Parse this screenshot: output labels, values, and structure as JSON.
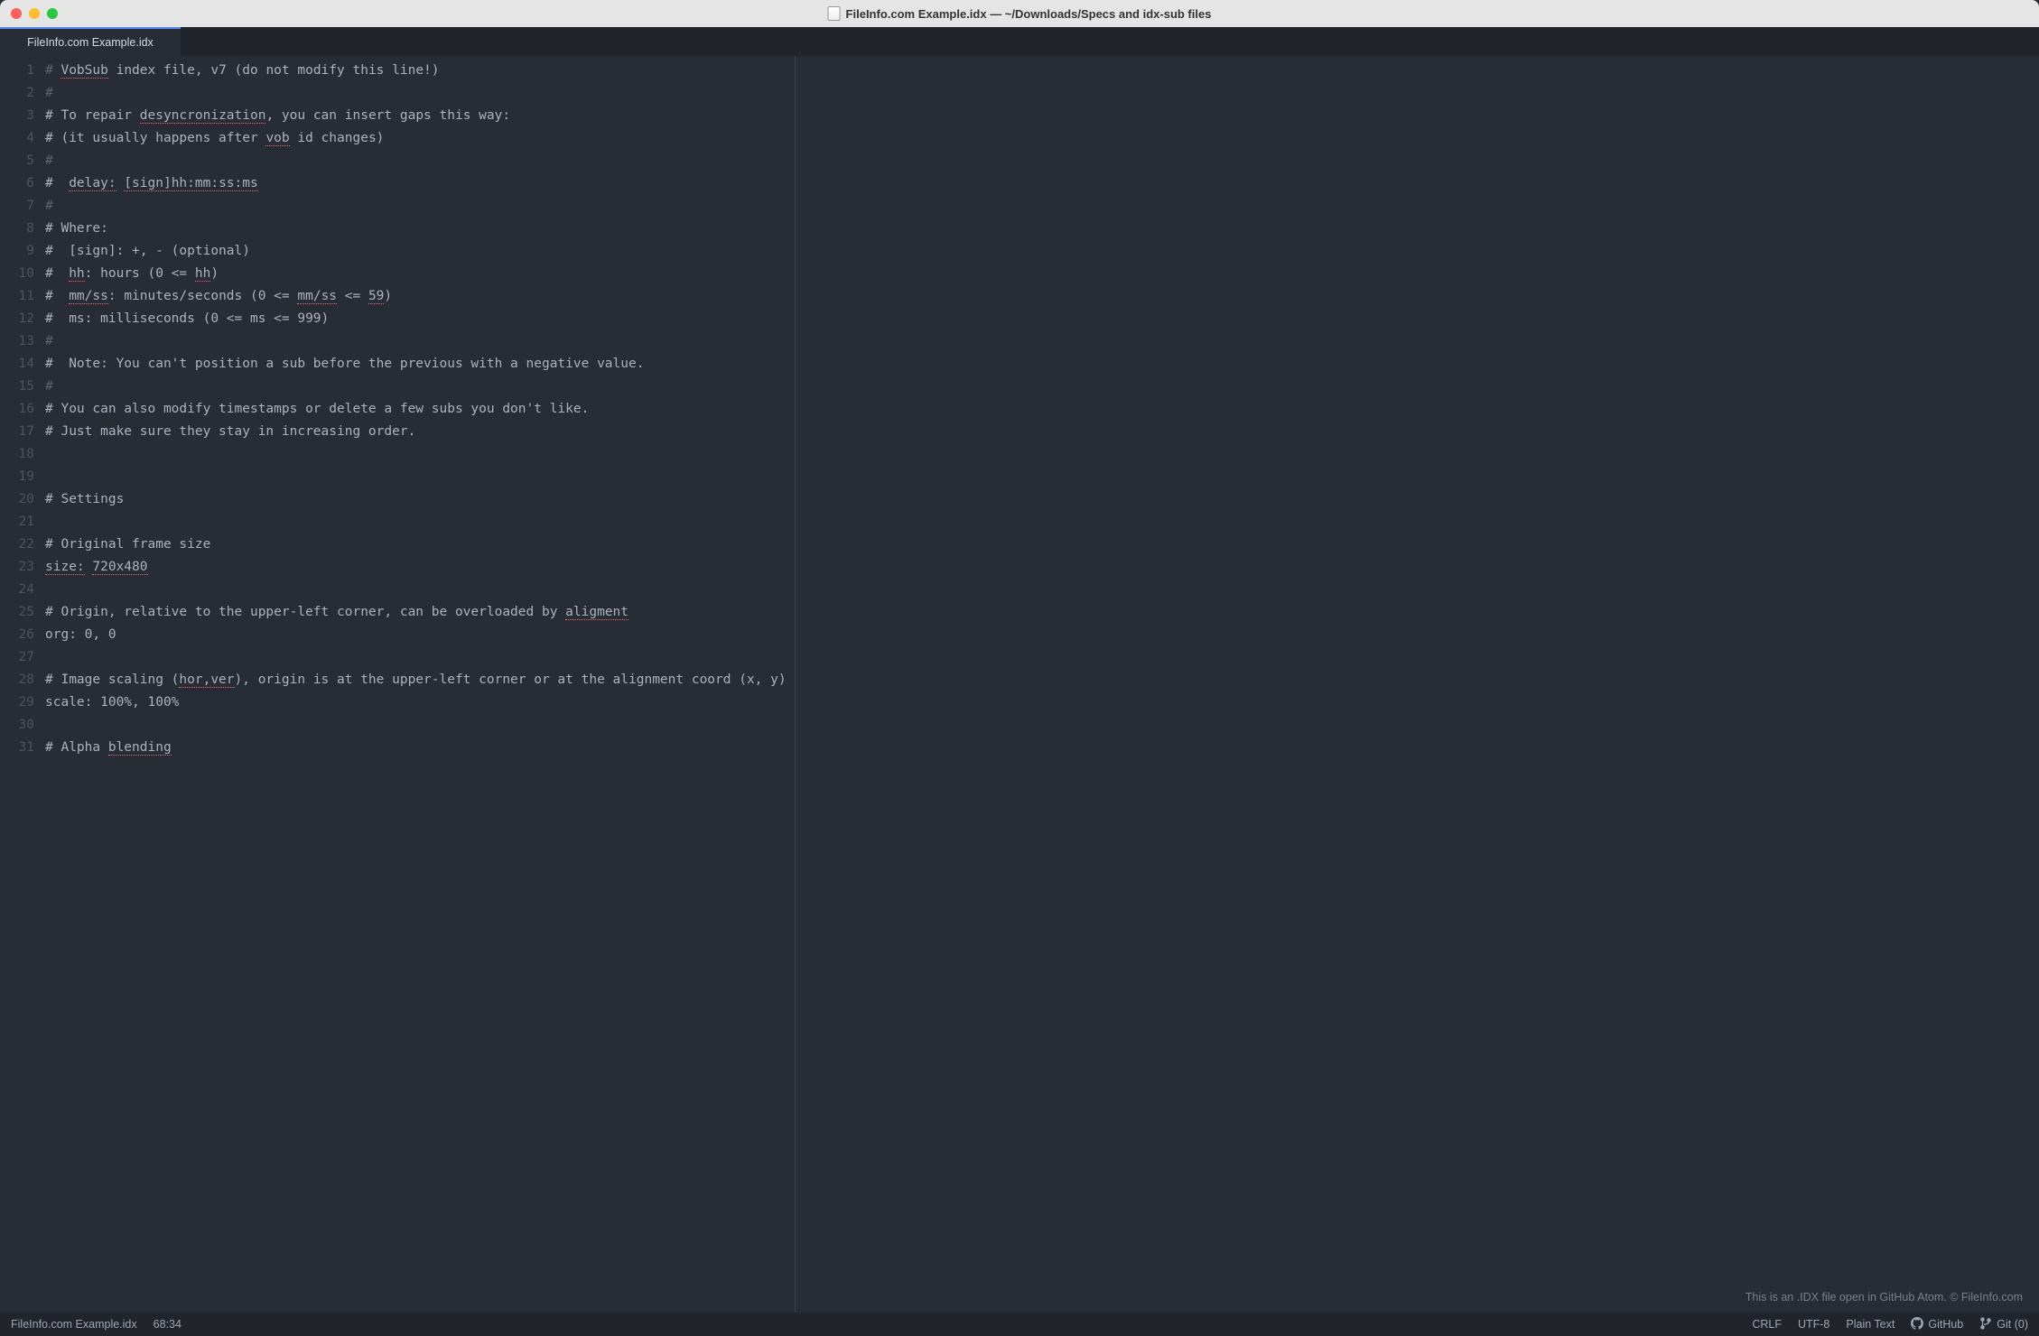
{
  "titlebar": {
    "title": "FileInfo.com Example.idx — ~/Downloads/Specs and idx-sub files"
  },
  "tab": {
    "label": "FileInfo.com Example.idx"
  },
  "editor": {
    "lines": [
      {
        "n": "1",
        "segs": [
          {
            "t": "# ",
            "c": "c"
          },
          {
            "t": "VobSub",
            "s": 1
          },
          {
            "t": " index file, v7 (do not modify this line!)"
          }
        ]
      },
      {
        "n": "2",
        "segs": [
          {
            "t": "#",
            "c": "c"
          }
        ]
      },
      {
        "n": "3",
        "segs": [
          {
            "t": "# To repair ",
            "c": "t"
          },
          {
            "t": "desyncronization",
            "s": 1
          },
          {
            "t": ", you can insert gaps this way:"
          }
        ]
      },
      {
        "n": "4",
        "segs": [
          {
            "t": "# (it usually happens after ",
            "c": "t"
          },
          {
            "t": "vob",
            "s": 1
          },
          {
            "t": " id changes)"
          }
        ]
      },
      {
        "n": "5",
        "segs": [
          {
            "t": "#",
            "c": "c"
          }
        ]
      },
      {
        "n": "6",
        "segs": [
          {
            "t": "#  ",
            "c": "t"
          },
          {
            "t": "delay:",
            "s": 1
          },
          {
            "t": " ",
            "c": "t"
          },
          {
            "t": "[sign]hh:mm:ss:ms",
            "s": 1
          }
        ]
      },
      {
        "n": "7",
        "segs": [
          {
            "t": "#",
            "c": "c"
          }
        ]
      },
      {
        "n": "8",
        "segs": [
          {
            "t": "# Where:"
          }
        ]
      },
      {
        "n": "9",
        "segs": [
          {
            "t": "#  [sign]: +, - (optional)"
          }
        ]
      },
      {
        "n": "10",
        "segs": [
          {
            "t": "#  ",
            "c": "t"
          },
          {
            "t": "hh",
            "s": 1
          },
          {
            "t": ": hours (0 <= "
          },
          {
            "t": "hh",
            "s": 1
          },
          {
            "t": ")"
          }
        ]
      },
      {
        "n": "11",
        "segs": [
          {
            "t": "#  ",
            "c": "t"
          },
          {
            "t": "mm/ss",
            "s": 1
          },
          {
            "t": ": minutes/seconds (0 <= "
          },
          {
            "t": "mm/ss",
            "s": 1
          },
          {
            "t": " <= "
          },
          {
            "t": "59",
            "s": 1
          },
          {
            "t": ")"
          }
        ]
      },
      {
        "n": "12",
        "segs": [
          {
            "t": "#  ms: milliseconds (0 <= ms <= 999)"
          }
        ]
      },
      {
        "n": "13",
        "segs": [
          {
            "t": "#",
            "c": "c"
          }
        ]
      },
      {
        "n": "14",
        "segs": [
          {
            "t": "#  Note: You can't position a sub before the previous with a negative value."
          }
        ]
      },
      {
        "n": "15",
        "segs": [
          {
            "t": "#",
            "c": "c"
          }
        ]
      },
      {
        "n": "16",
        "segs": [
          {
            "t": "# You can also modify timestamps or delete a few subs you don't like."
          }
        ]
      },
      {
        "n": "17",
        "segs": [
          {
            "t": "# Just make sure they stay in increasing order."
          }
        ]
      },
      {
        "n": "18",
        "segs": [
          {
            "t": ""
          }
        ]
      },
      {
        "n": "19",
        "segs": [
          {
            "t": ""
          }
        ]
      },
      {
        "n": "20",
        "segs": [
          {
            "t": "# Settings"
          }
        ]
      },
      {
        "n": "21",
        "segs": [
          {
            "t": ""
          }
        ]
      },
      {
        "n": "22",
        "segs": [
          {
            "t": "# Original frame size"
          }
        ]
      },
      {
        "n": "23",
        "segs": [
          {
            "t": "size:",
            "s": 1
          },
          {
            "t": " "
          },
          {
            "t": "720x480",
            "s": 1
          }
        ]
      },
      {
        "n": "24",
        "segs": [
          {
            "t": ""
          }
        ]
      },
      {
        "n": "25",
        "segs": [
          {
            "t": "# Origin, relative to the upper-left corner, can be overloaded by "
          },
          {
            "t": "aligment",
            "s": 1
          }
        ]
      },
      {
        "n": "26",
        "segs": [
          {
            "t": "org: 0, 0"
          }
        ]
      },
      {
        "n": "27",
        "segs": [
          {
            "t": ""
          }
        ]
      },
      {
        "n": "28",
        "segs": [
          {
            "t": "# Image scaling ("
          },
          {
            "t": "hor,ver",
            "s": 1
          },
          {
            "t": "), origin is at the upper-left corner or at the alignment coord (x, y)"
          }
        ]
      },
      {
        "n": "29",
        "segs": [
          {
            "t": "scale: 100%, 100%"
          }
        ]
      },
      {
        "n": "30",
        "segs": [
          {
            "t": ""
          }
        ]
      },
      {
        "n": "31",
        "segs": [
          {
            "t": "# Alpha "
          },
          {
            "t": "blending",
            "s": 1
          }
        ]
      }
    ]
  },
  "watermark": "This is an .IDX file open in GitHub Atom. © FileInfo.com",
  "status": {
    "file": "FileInfo.com Example.idx",
    "cursor": "68:34",
    "eol": "CRLF",
    "encoding": "UTF-8",
    "grammar": "Plain Text",
    "github": "GitHub",
    "git": "Git (0)"
  }
}
